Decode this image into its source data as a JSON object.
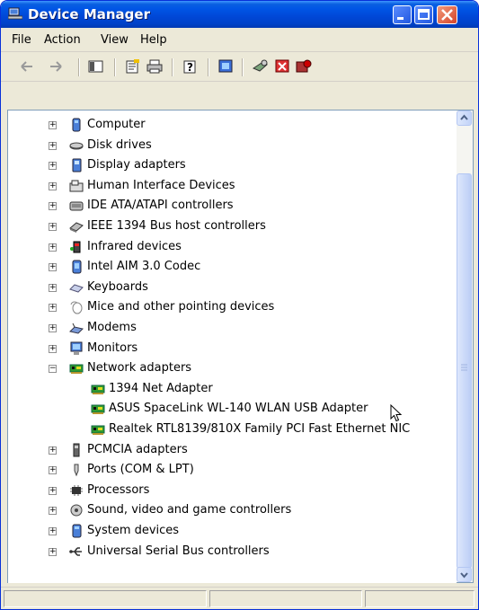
{
  "window": {
    "title": "Device Manager"
  },
  "menu": {
    "items": [
      "File",
      "Action",
      "View",
      "Help"
    ]
  },
  "toolbar": {
    "icons": [
      "back-icon",
      "forward-icon",
      "show-hide-tree-icon",
      "properties-icon",
      "print-icon",
      "help-icon",
      "update-driver-icon",
      "scan-hardware-icon",
      "uninstall-icon",
      "disable-icon"
    ]
  },
  "tree": {
    "items": [
      {
        "label": "Computer",
        "icon": "computer-icon",
        "expanded": false
      },
      {
        "label": "Disk drives",
        "icon": "disk-drive-icon",
        "expanded": false
      },
      {
        "label": "Display adapters",
        "icon": "display-adapter-icon",
        "expanded": false
      },
      {
        "label": "Human Interface Devices",
        "icon": "hid-icon",
        "expanded": false
      },
      {
        "label": "IDE ATA/ATAPI controllers",
        "icon": "ide-controller-icon",
        "expanded": false
      },
      {
        "label": "IEEE 1394 Bus host controllers",
        "icon": "ieee1394-icon",
        "expanded": false
      },
      {
        "label": "Infrared devices",
        "icon": "infrared-icon",
        "expanded": false
      },
      {
        "label": "Intel AIM 3.0 Codec",
        "icon": "codec-icon",
        "expanded": false
      },
      {
        "label": "Keyboards",
        "icon": "keyboard-icon",
        "expanded": false
      },
      {
        "label": "Mice and other pointing devices",
        "icon": "mouse-icon",
        "expanded": false
      },
      {
        "label": "Modems",
        "icon": "modem-icon",
        "expanded": false
      },
      {
        "label": "Monitors",
        "icon": "monitor-icon",
        "expanded": false
      },
      {
        "label": "Network adapters",
        "icon": "network-adapter-icon",
        "expanded": true,
        "children": [
          {
            "label": "1394 Net Adapter",
            "icon": "network-card-icon"
          },
          {
            "label": "ASUS SpaceLink WL-140 WLAN USB Adapter",
            "icon": "network-card-icon"
          },
          {
            "label": "Realtek RTL8139/810X Family PCI Fast Ethernet NIC",
            "icon": "network-card-icon"
          }
        ]
      },
      {
        "label": "PCMCIA adapters",
        "icon": "pcmcia-icon",
        "expanded": false
      },
      {
        "label": "Ports (COM & LPT)",
        "icon": "port-icon",
        "expanded": false
      },
      {
        "label": "Processors",
        "icon": "processor-icon",
        "expanded": false
      },
      {
        "label": "Sound, video and game controllers",
        "icon": "sound-icon",
        "expanded": false
      },
      {
        "label": "System devices",
        "icon": "system-device-icon",
        "expanded": false
      },
      {
        "label": "Universal Serial Bus controllers",
        "icon": "usb-icon",
        "expanded": false
      }
    ]
  },
  "colors": {
    "titlebar": "#0055e5",
    "chrome": "#ece9d8",
    "pane_border": "#7f9db9"
  }
}
